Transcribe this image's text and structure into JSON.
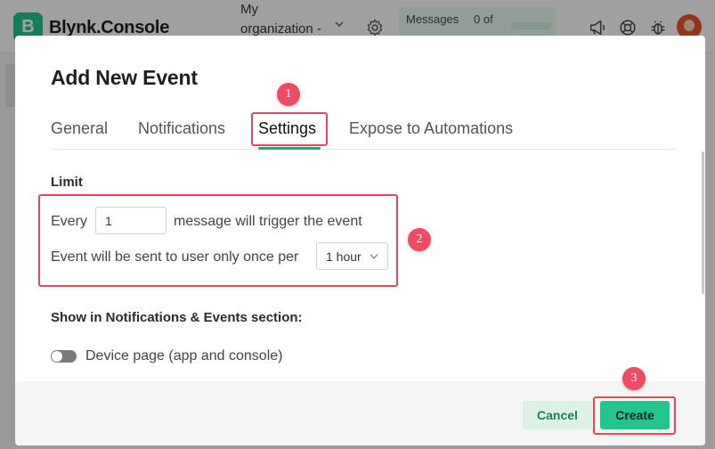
{
  "app": {
    "logo_letter": "B",
    "name": "Blynk.Console",
    "org_label": "My organization -",
    "messages_label": "Messages",
    "messages_count": "0 of"
  },
  "modal": {
    "title": "Add New Event",
    "tabs": [
      {
        "label": "General",
        "active": false
      },
      {
        "label": "Notifications",
        "active": false
      },
      {
        "label": "Settings",
        "active": true
      },
      {
        "label": "Expose to Automations",
        "active": false
      }
    ],
    "limit": {
      "section_label": "Limit",
      "every_label": "Every",
      "every_value": "1",
      "trigger_text": "message will trigger the event",
      "once_per_text": "Event will be sent to user only once per",
      "interval_value": "1 hour"
    },
    "show_in": {
      "section_label": "Show in Notifications & Events section:",
      "device_page_label": "Device page (app and console)",
      "device_page_enabled": false
    },
    "buttons": {
      "cancel": "Cancel",
      "create": "Create"
    }
  },
  "annotations": [
    "1",
    "2",
    "3"
  ],
  "colors": {
    "accent": "#23c48e",
    "annotation": "#ee4b64",
    "tab_underline": "#23a675"
  }
}
